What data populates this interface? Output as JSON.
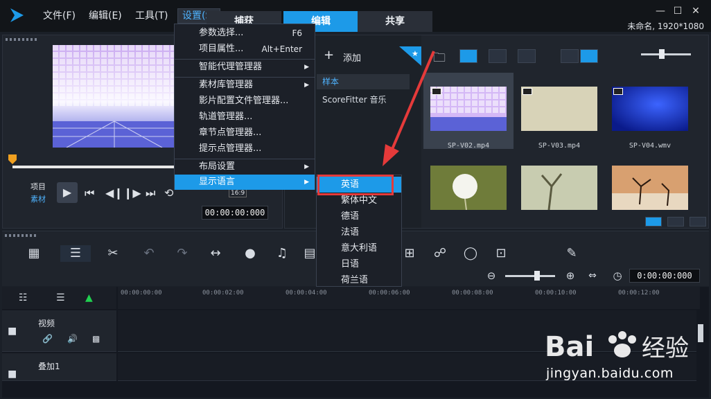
{
  "menu": {
    "file": "文件(F)",
    "edit": "编辑(E)",
    "tools": "工具(T)",
    "settings": "设置(S)"
  },
  "tabs": {
    "capture": "捕获",
    "edit": "编辑",
    "share": "共享"
  },
  "project_info": "未命名, 1920*1080",
  "preview": {
    "project_label": "项目",
    "clip_label": "素材",
    "aspect": "16:9",
    "timecode": "00:00:00:000"
  },
  "library": {
    "add_label": "添加",
    "items": [
      "样本",
      "ScoreFitter 音乐"
    ],
    "thumbnails": [
      {
        "name": "SP-V02.mp4"
      },
      {
        "name": "SP-V03.mp4"
      },
      {
        "name": "SP-V04.wmv"
      },
      {
        "name": ""
      },
      {
        "name": ""
      },
      {
        "name": ""
      }
    ]
  },
  "dropdown": {
    "items": [
      {
        "label": "参数选择...",
        "shortcut": "F6"
      },
      {
        "label": "项目属性...",
        "shortcut": "Alt+Enter"
      },
      {
        "label": "智能代理管理器"
      },
      {
        "label": "素材库管理器"
      },
      {
        "label": "影片配置文件管理器..."
      },
      {
        "label": "轨道管理器..."
      },
      {
        "label": "章节点管理器..."
      },
      {
        "label": "提示点管理器..."
      },
      {
        "label": "布局设置"
      },
      {
        "label": "显示语言"
      }
    ]
  },
  "language_submenu": [
    "英语",
    "繁体中文",
    "德语",
    "法语",
    "意大利语",
    "日语",
    "荷兰语"
  ],
  "timeline": {
    "timecode": "0:00:00:000",
    "ruler": [
      "00:00:00:00",
      "00:00:02:00",
      "00:00:04:00",
      "00:00:06:00",
      "00:00:08:00",
      "00:00:10:00",
      "00:00:12:00"
    ],
    "tracks": [
      {
        "name": "视频"
      },
      {
        "name": "叠加1"
      }
    ]
  },
  "watermark": {
    "text": "jingyan.baidu.com"
  }
}
